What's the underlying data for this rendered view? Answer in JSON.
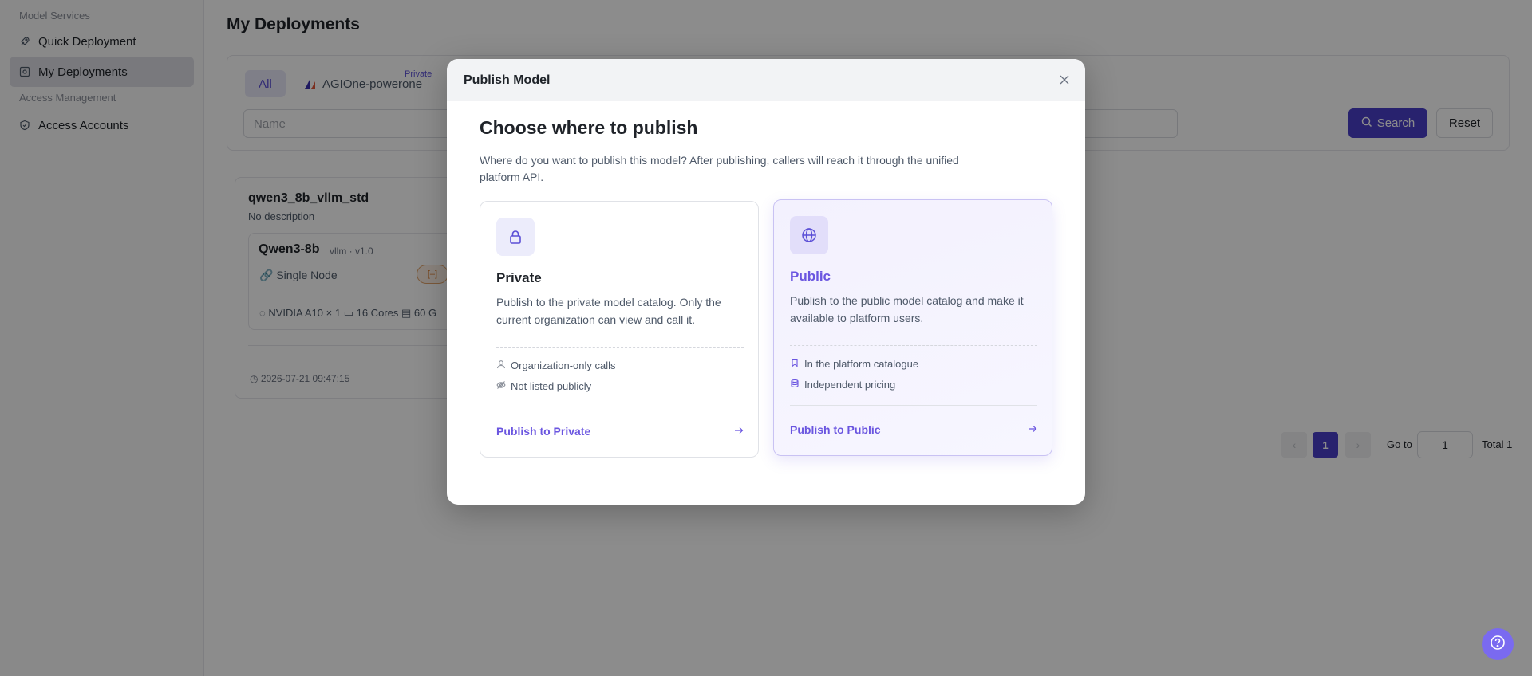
{
  "sidebar": {
    "group_model_services": "Model Services",
    "items": [
      {
        "label": "Quick Deployment",
        "icon": "rocket-icon"
      },
      {
        "label": "My Deployments",
        "icon": "deployments-icon"
      },
      {
        "label": "Access Accounts",
        "icon": "shield-icon"
      }
    ],
    "group_access_management": "Access Management"
  },
  "page": {
    "title": "My Deployments",
    "tabs": {
      "all": "All",
      "agione": "AGIOne-powerone",
      "private_tag": "Private"
    },
    "name_placeholder": "Name",
    "search_button": "Search",
    "reset_button": "Reset"
  },
  "deployment": {
    "name": "qwen3_8b_vllm_std",
    "description": "No description",
    "model_name": "Qwen3-8b",
    "model_meta": "vllm · v1.0",
    "node_type": "Single Node",
    "hardware": {
      "gpu": "NVIDIA A10 × 1",
      "cpu": "16 Cores",
      "mem": "60 G"
    },
    "created_at": "2026-07-21 09:47:15"
  },
  "pagination": {
    "prev": "‹",
    "current": "1",
    "next": "›",
    "goto_label": "Go to",
    "goto_value": "1",
    "total": "Total 1"
  },
  "modal": {
    "title": "Publish Model",
    "heading": "Choose where to publish",
    "description": "Where do you want to publish this model? After publishing, callers will reach it through the unified platform API.",
    "options": {
      "private": {
        "title": "Private",
        "description": "Publish to the private model catalog. Only the current organization can view and call it.",
        "features": [
          "Organization-only calls",
          "Not listed publicly"
        ],
        "action": "Publish to Private"
      },
      "public": {
        "title": "Public",
        "description": "Publish to the public model catalog and make it available to platform users.",
        "features": [
          "In the platform catalogue",
          "Independent pricing"
        ],
        "action": "Publish to Public"
      }
    }
  },
  "colors": {
    "accent": "#4a3fc8",
    "accent_light": "#6a55e0",
    "overlay": "rgba(0,0,0,0.45)"
  }
}
